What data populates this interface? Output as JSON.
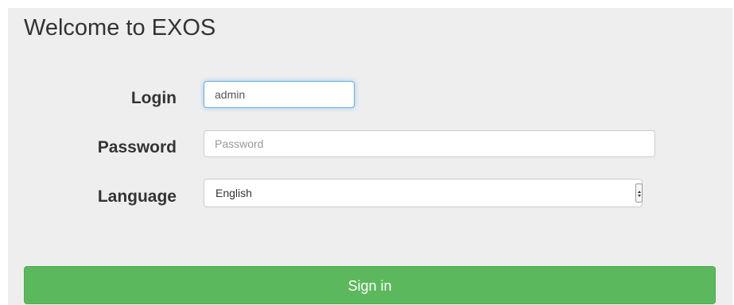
{
  "page": {
    "title": "Welcome to EXOS"
  },
  "form": {
    "login": {
      "label": "Login",
      "value": "admin"
    },
    "password": {
      "label": "Password",
      "placeholder": "Password",
      "value": ""
    },
    "language": {
      "label": "Language",
      "selected": "English"
    },
    "submit_label": "Sign in"
  },
  "colors": {
    "panel_background": "#eeeeee",
    "submit_button": "#5cb85c",
    "focus_border": "#66afe9"
  },
  "icons": {
    "language_dropdown": "select-stepper-icon"
  }
}
